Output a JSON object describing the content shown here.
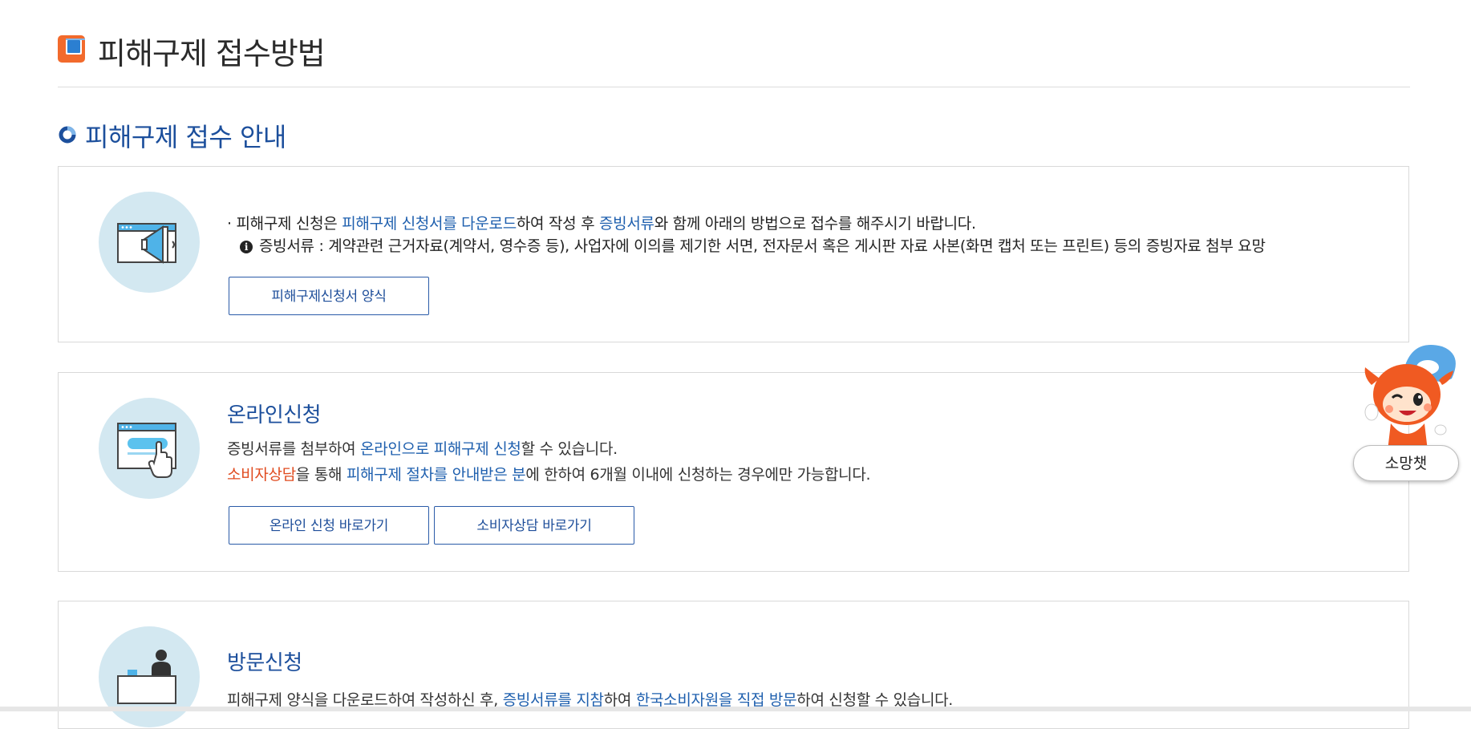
{
  "header": {
    "title": "피해구제 접수방법"
  },
  "section": {
    "title": "피해구제 접수 안내"
  },
  "notice": {
    "bullet": "·",
    "line1_pre": " 피해구제 신청은 ",
    "line1_link": "피해구제 신청서를 다운로드",
    "line1_mid": "하여 작성 후 ",
    "line1_docs": "증빙서류",
    "line1_post": "와 함께 아래의 방법으로 접수를 해주시기 바랍니다.",
    "info_icon": "i",
    "line2": "증빙서류 : 계약관련 근거자료(계약서, 영수증 등), 사업자에 이의를 제기한 서면, 전자문서 혹은 게시판 자료 사본(화면 캡처 또는 프린트) 등의 증빙자료 첨부 요망",
    "button": "피해구제신청서 양식"
  },
  "online": {
    "title": "온라인신청",
    "l1_pre": "증빙서류를 첨부하여 ",
    "l1_hl": "온라인으로 피해구제 신청",
    "l1_post": "할 수 있습니다.",
    "l2_hl1": "소비자상담",
    "l2_mid": "을 통해 ",
    "l2_hl2": "피해구제 절차를 안내받은 분",
    "l2_post": "에 한하여 6개월 이내에 신청하는 경우에만 가능합니다.",
    "btn1": "온라인 신청 바로가기",
    "btn2": "소비자상담 바로가기"
  },
  "visit": {
    "title": "방문신청",
    "l1_pre": "피해구제 양식을 다운로드하여 작성하신 후, ",
    "l1_hl1": "증빙서류를 지참",
    "l1_mid": "하여 ",
    "l1_hl2": "한국소비자원을 직접 방문",
    "l1_post": "하여 신청할 수 있습니다."
  },
  "chatbot": {
    "label": "소망챗"
  },
  "colors": {
    "accent_blue": "#1c4f9c",
    "highlight_red": "#e04b1f",
    "icon_bg": "#d3e8f1",
    "orange": "#f26a2c"
  }
}
